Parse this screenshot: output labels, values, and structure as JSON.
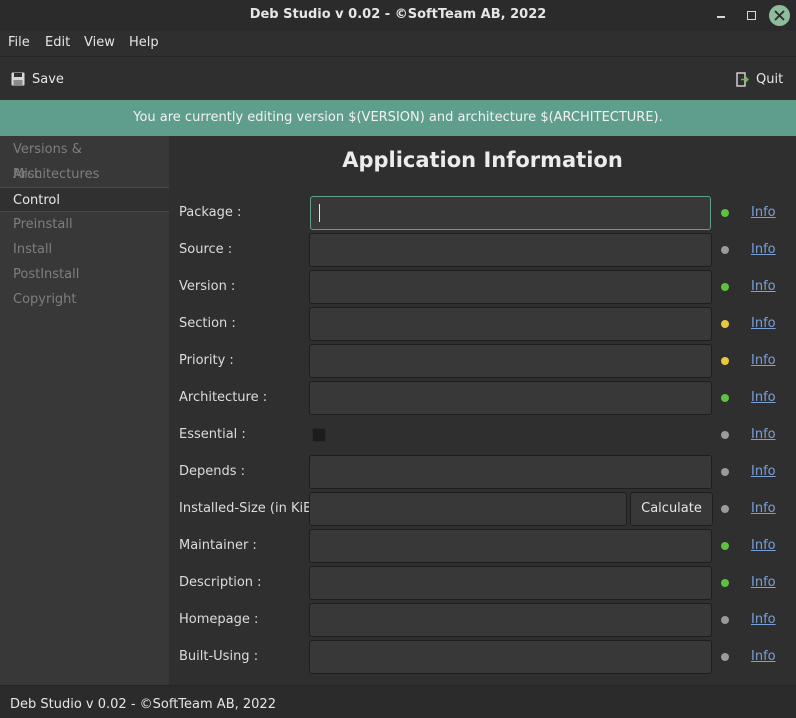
{
  "window": {
    "title": "Deb Studio v 0.02 - ©SoftTeam AB, 2022"
  },
  "menu": [
    "File",
    "Edit",
    "View",
    "Help"
  ],
  "toolbar": {
    "save": "Save",
    "quit": "Quit"
  },
  "banner": "You are currently editing version $(VERSION) and architecture $(ARCHITECTURE).",
  "sidebar": {
    "items": [
      "Versions & Architectures",
      "Misc",
      "Control",
      "Preinstall",
      "Install",
      "PostInstall",
      "Copyright"
    ],
    "active": "Control"
  },
  "main": {
    "title": "Application Information",
    "info_label": "Info",
    "calculate_label": "Calculate",
    "status_colors": {
      "green": "#5fc13e",
      "yellow": "#e9c93a",
      "gray": "#9a9a9a"
    },
    "fields": [
      {
        "label": "Package :",
        "value": "",
        "status": "green"
      },
      {
        "label": "Source :",
        "value": "",
        "status": "gray"
      },
      {
        "label": "Version :",
        "value": "",
        "status": "green"
      },
      {
        "label": "Section :",
        "value": "",
        "status": "yellow"
      },
      {
        "label": "Priority :",
        "value": "",
        "status": "yellow"
      },
      {
        "label": "Architecture :",
        "value": "",
        "status": "green"
      },
      {
        "label": "Essential :",
        "checked": false,
        "status": "gray"
      },
      {
        "label": "Depends :",
        "value": "",
        "status": "gray"
      },
      {
        "label": "Installed-Size (in KiB):",
        "value": "",
        "status": "gray"
      },
      {
        "label": "Maintainer :",
        "value": "",
        "status": "green"
      },
      {
        "label": "Description :",
        "value": "",
        "status": "green"
      },
      {
        "label": "Homepage :",
        "value": "",
        "status": "gray"
      },
      {
        "label": "Built-Using :",
        "value": "",
        "status": "gray"
      }
    ]
  },
  "statusbar": {
    "text": "Deb Studio v 0.02 - ©SoftTeam AB, 2022"
  }
}
